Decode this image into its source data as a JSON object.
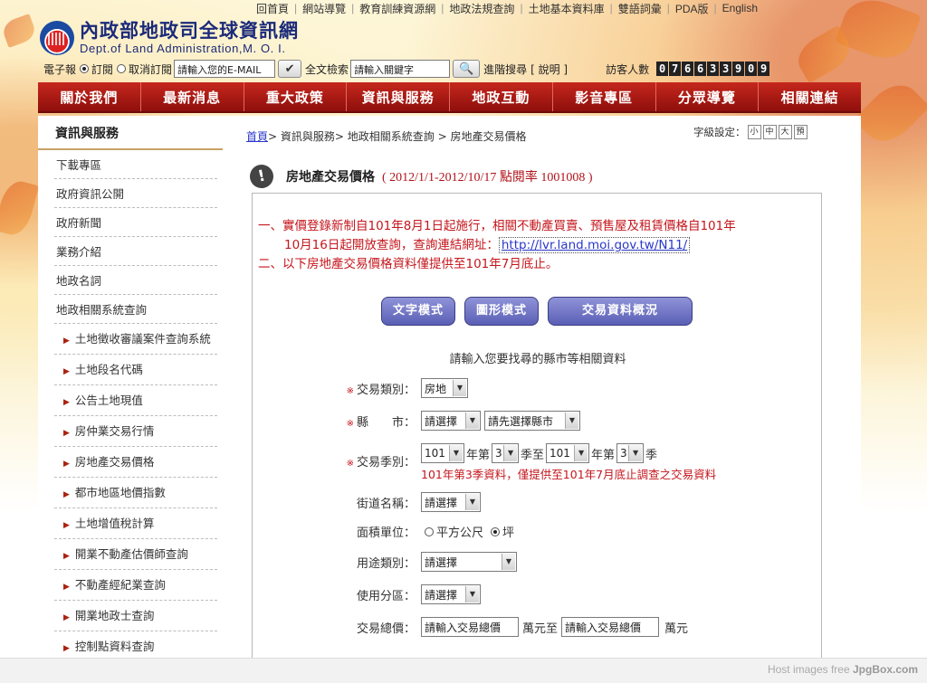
{
  "toplinks": [
    "回首頁",
    "網站導覽",
    "教育訓練資源網",
    "地政法規查詢",
    "土地基本資料庫",
    "雙語詞彙",
    "PDA版",
    "English"
  ],
  "logo": {
    "title": "內政部地政司全球資訊網",
    "subtitle": "Dept.of Land Administration,M. O. I."
  },
  "subscribe": {
    "epaper_label": "電子報",
    "subscribe_label": "訂閱",
    "unsubscribe_label": "取消訂閱",
    "email_placeholder": "請輸入您的E-MAIL",
    "fulltext_label": "全文檢索",
    "keyword_placeholder": "請輸入關鍵字",
    "advanced_label": "進階搜尋",
    "help_label": "[ 說明 ]",
    "visitor_label": "訪客人數",
    "visitor_count": [
      "0",
      "7",
      "6",
      "6",
      "3",
      "3",
      "9",
      "0",
      "9"
    ]
  },
  "nav": [
    "關於我們",
    "最新消息",
    "重大政策",
    "資訊與服務",
    "地政互動",
    "影音專區",
    "分眾導覽",
    "相關連結"
  ],
  "sidebar": {
    "title": "資訊與服務",
    "items": [
      "下載專區",
      "政府資訊公開",
      "政府新聞",
      "業務介紹",
      "地政名詞",
      "地政相關系統查詢"
    ],
    "subitems": [
      "土地徵收審議案件查詢系統",
      "土地段名代碼",
      "公告土地現值",
      "房仲業交易行情",
      "房地產交易價格",
      "都市地區地價指數",
      "土地增值稅計算",
      "開業不動產估價師查詢",
      "不動產經紀業查詢",
      "開業地政士查詢",
      "控制點資料查詢"
    ]
  },
  "breadcrumb": {
    "home": "首頁",
    "path": "> 資訊與服務> 地政相關系統查詢 > 房地產交易價格"
  },
  "fontsize": {
    "label": "字級設定：",
    "small": "小",
    "mid": "中",
    "large": "大",
    "default": "預"
  },
  "page": {
    "title": "房地產交易價格",
    "subtitle": "( 2012/1/1-2012/10/17 點閱率 1001008 )"
  },
  "notice": {
    "line1": "一、實價登錄新制自101年8月1日起施行，相關不動產買賣、預售屋及租賃價格自101年",
    "line2": "10月16日起開放查詢，查詢連結網址：",
    "link": "http://lvr.land.moi.gov.tw/N11/",
    "line3": "二、以下房地產交易價格資料僅提供至101年7月底止。"
  },
  "modes": [
    "文字模式",
    "圖形模式",
    "交易資料概況"
  ],
  "prompt": "請輸入您要找尋的縣市等相關資料",
  "form": {
    "type_label": "交易類別：",
    "type_value": "房地",
    "city_label": "縣　　市：",
    "city_value": "請選擇",
    "district_value": "請先選擇縣市",
    "season_label": "交易季別：",
    "year_from": "101",
    "year_word": "年第",
    "season_from": "3",
    "season_to_word": "季至",
    "year_to": "101",
    "season_to": "3",
    "season_word": "季",
    "season_note": "101年第3季資料，僅提供至101年7月底止調查之交易資料",
    "street_label": "街道名稱：",
    "street_value": "請選擇",
    "area_label": "面積單位：",
    "area_opt1": "平方公尺",
    "area_opt2": "坪",
    "use_label": "用途類別：",
    "use_value": "請選擇",
    "zone_label": "使用分區：",
    "zone_value": "請選擇",
    "price_label": "交易總價：",
    "price_min_placeholder": "請輸入交易總價",
    "price_mid": "萬元至",
    "price_max_placeholder": "請輸入交易總價",
    "price_unit": "萬元"
  },
  "watermark": {
    "text": "Host images free",
    "brand": "JpgBox.com"
  }
}
